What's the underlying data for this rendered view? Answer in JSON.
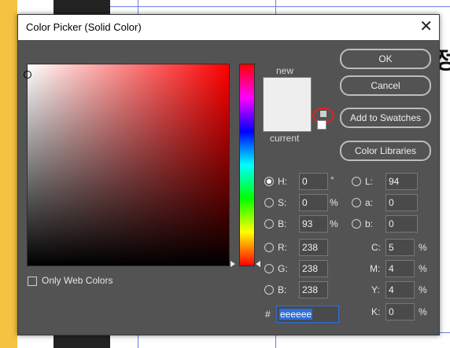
{
  "background": {
    "korean_glyph": "정"
  },
  "dialog": {
    "title": "Color Picker (Solid Color)",
    "close_glyph": "✕"
  },
  "buttons": {
    "ok": "OK",
    "cancel": "Cancel",
    "add_to_swatches": "Add to Swatches",
    "color_libraries": "Color Libraries"
  },
  "preview": {
    "new_label": "new",
    "current_label": "current",
    "new_color": "#eeeeee",
    "current_color": "#eeeeee"
  },
  "only_web_colors": {
    "label": "Only Web Colors",
    "checked": false
  },
  "hsb": {
    "h": {
      "label": "H:",
      "value": "0",
      "unit": "°",
      "selected": true
    },
    "s": {
      "label": "S:",
      "value": "0",
      "unit": "%",
      "selected": false
    },
    "b": {
      "label": "B:",
      "value": "93",
      "unit": "%",
      "selected": false
    }
  },
  "rgb": {
    "r": {
      "label": "R:",
      "value": "238"
    },
    "g": {
      "label": "G:",
      "value": "238"
    },
    "b": {
      "label": "B:",
      "value": "238"
    }
  },
  "lab": {
    "l": {
      "label": "L:",
      "value": "94"
    },
    "a": {
      "label": "a:",
      "value": "0"
    },
    "b": {
      "label": "b:",
      "value": "0"
    }
  },
  "cmyk": {
    "c": {
      "label": "C:",
      "value": "5",
      "unit": "%"
    },
    "m": {
      "label": "M:",
      "value": "4",
      "unit": "%"
    },
    "y": {
      "label": "Y:",
      "value": "4",
      "unit": "%"
    },
    "k": {
      "label": "K:",
      "value": "0",
      "unit": "%"
    }
  },
  "hex": {
    "label": "#",
    "value": "eeeeee"
  },
  "colors": {
    "dialog_bg": "#535353",
    "selection_blue": "#2d6ed8",
    "warning_ring": "#e62020"
  }
}
